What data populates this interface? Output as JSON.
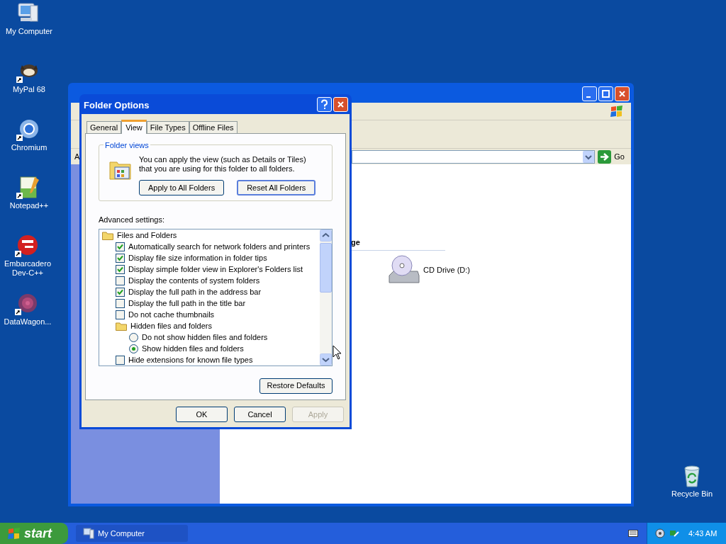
{
  "desktop_icons": [
    {
      "label": "My Computer",
      "kind": "computer"
    },
    {
      "label": "MyPal 68",
      "kind": "raccoon"
    },
    {
      "label": "Chromium",
      "kind": "chromium"
    },
    {
      "label": "Notepad++",
      "kind": "notepad"
    },
    {
      "label": "Embarcadero Dev-C++",
      "kind": "devcpp"
    },
    {
      "label": "DataWagon...",
      "kind": "datawagon"
    },
    {
      "label": "Recycle Bin",
      "kind": "recycle"
    }
  ],
  "explorer_window": {
    "address_label": "A",
    "go_button": "Go",
    "section_heading": "ge",
    "drives": [
      {
        "label": "CD Drive (D:)"
      }
    ]
  },
  "dialog": {
    "title": "Folder Options",
    "tabs": [
      {
        "label": "General",
        "selected": false
      },
      {
        "label": "View",
        "selected": true
      },
      {
        "label": "File Types",
        "selected": false
      },
      {
        "label": "Offline Files",
        "selected": false
      }
    ],
    "folder_views": {
      "legend": "Folder views",
      "text": "You can apply the view (such as Details or Tiles) that you are using for this folder to all folders.",
      "buttons": [
        {
          "label": "Apply to All Folders",
          "focused": false
        },
        {
          "label": "Reset All Folders",
          "focused": true
        }
      ]
    },
    "advanced_label": "Advanced settings:",
    "settings": [
      {
        "kind": "folder",
        "label": "Files and Folders",
        "children": [
          {
            "kind": "checkbox",
            "label": "Automatically search for network folders and printers",
            "checked": true
          },
          {
            "kind": "checkbox",
            "label": "Display file size information in folder tips",
            "checked": true
          },
          {
            "kind": "checkbox",
            "label": "Display simple folder view in Explorer's Folders list",
            "checked": true
          },
          {
            "kind": "checkbox",
            "label": "Display the contents of system folders",
            "checked": false
          },
          {
            "kind": "checkbox",
            "label": "Display the full path in the address bar",
            "checked": true
          },
          {
            "kind": "checkbox",
            "label": "Display the full path in the title bar",
            "checked": false
          },
          {
            "kind": "checkbox",
            "label": "Do not cache thumbnails",
            "checked": false
          },
          {
            "kind": "folder",
            "label": "Hidden files and folders",
            "children": [
              {
                "kind": "radio",
                "label": "Do not show hidden files and folders",
                "checked": false
              },
              {
                "kind": "radio",
                "label": "Show hidden files and folders",
                "checked": true
              }
            ]
          },
          {
            "kind": "checkbox",
            "label": "Hide extensions for known file types",
            "checked": false
          }
        ]
      }
    ],
    "restore_button": "Restore Defaults",
    "buttons": [
      {
        "label": "OK",
        "disabled": false
      },
      {
        "label": "Cancel",
        "disabled": false
      },
      {
        "label": "Apply",
        "disabled": true
      }
    ]
  },
  "taskbar": {
    "start": "start",
    "tasks": [
      {
        "label": "My Computer"
      }
    ],
    "clock": "4:43 AM"
  }
}
